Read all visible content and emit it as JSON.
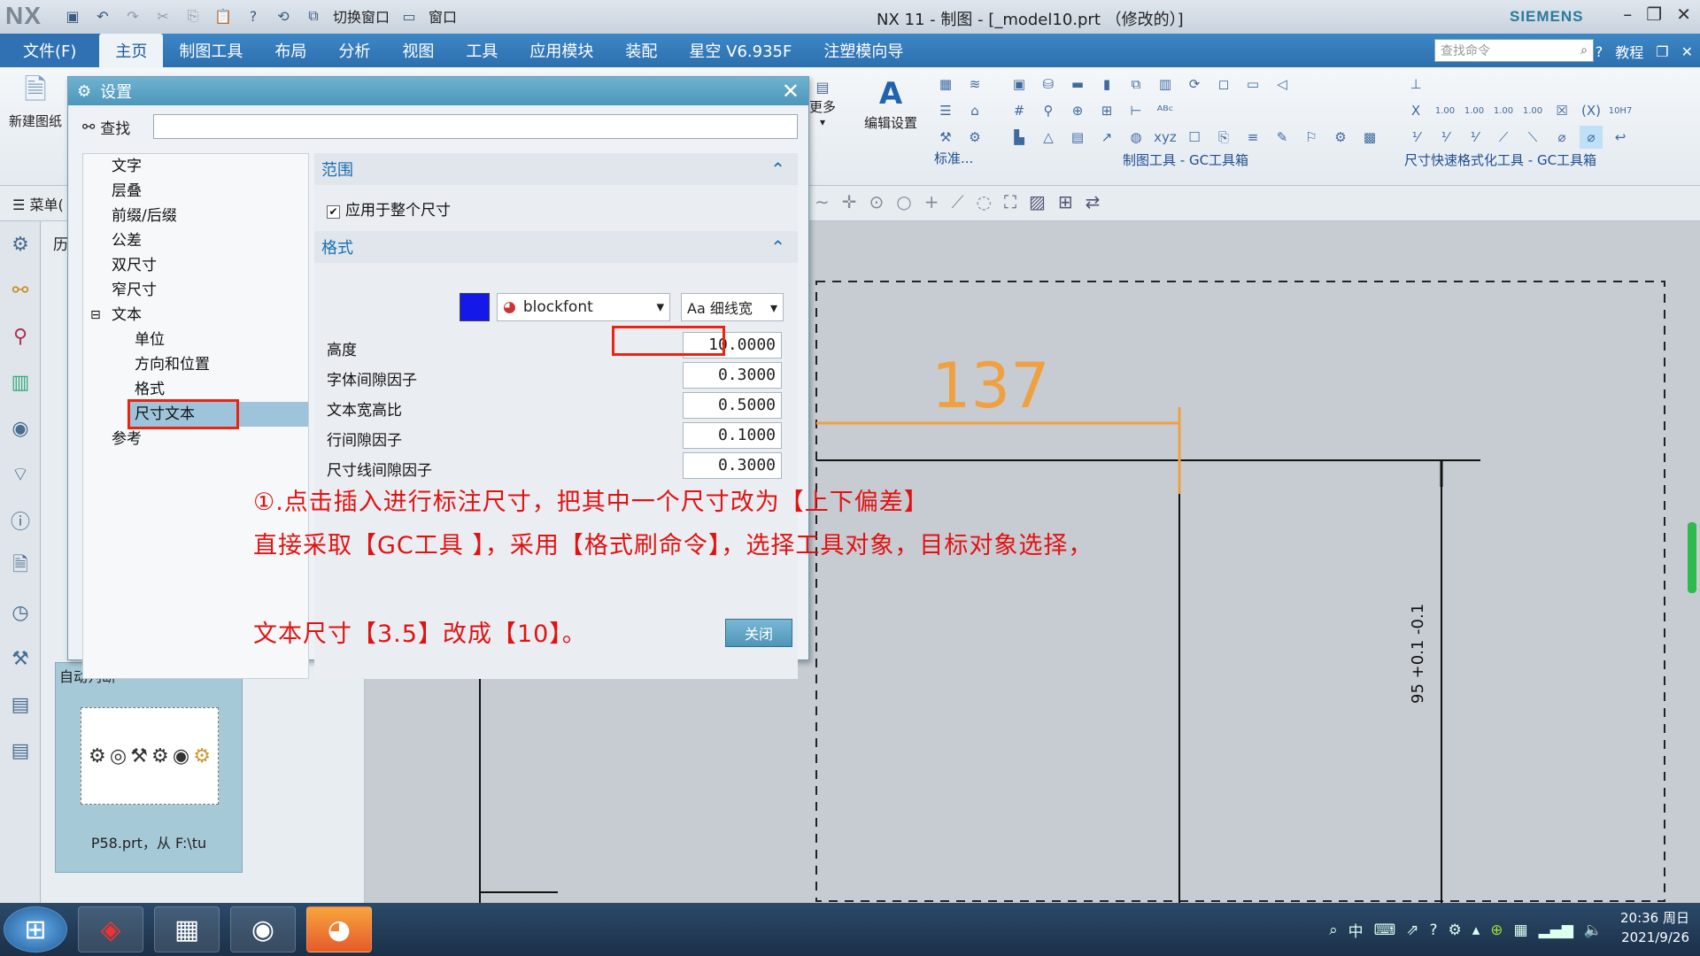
{
  "titlebar": {
    "logo": "NX",
    "switch_window": "切换窗口",
    "window": "窗口",
    "title": "NX 11 - 制图 - [_model10.prt （修改的）]",
    "brand": "SIEMENS"
  },
  "menu": {
    "tabs": [
      "文件(F)",
      "主页",
      "制图工具",
      "布局",
      "分析",
      "视图",
      "工具",
      "应用模块",
      "装配",
      "星空 V6.935F",
      "注塑模向导"
    ],
    "active_tab": "主页",
    "search_placeholder": "查找命令",
    "tutorial": "教程"
  },
  "ribbon": {
    "new_sheet": "新建图纸",
    "more": "更多",
    "edit_settings": "编辑设置",
    "standard": "标准...",
    "group_gc": "制图工具 - GC工具箱",
    "group_dim": "尺寸快速格式化工具 - GC工具箱",
    "dim_labels": [
      "1.00",
      "1.00",
      "1.00",
      "1.00",
      "10H7"
    ]
  },
  "toolbar2": {
    "menu": "菜单("
  },
  "resource": {
    "history_label": "历",
    "auto_label": "自动判断",
    "file_label": "P58.prt，从 F:\\tu"
  },
  "dialog": {
    "title": "设置",
    "find_label": "查找",
    "tree": [
      "文字",
      "层叠",
      "前缀/后缀",
      "公差",
      "双尺寸",
      "窄尺寸",
      "文本",
      "单位",
      "方向和位置",
      "格式",
      "尺寸文本",
      "参考"
    ],
    "selected_tree_item": "尺寸文本",
    "scope_header": "范围",
    "apply_all": "应用于整个尺寸",
    "apply_all_checked": true,
    "format_header": "格式",
    "color": "#1418e8",
    "font": "blockfont",
    "style": "Aa 细线宽",
    "fields": [
      {
        "label": "高度",
        "value": "10.0000"
      },
      {
        "label": "字体间隙因子",
        "value": "0.3000"
      },
      {
        "label": "文本宽高比",
        "value": "0.5000"
      },
      {
        "label": "行间隙因子",
        "value": "0.1000"
      },
      {
        "label": "尺寸线间隙因子",
        "value": "0.3000"
      }
    ],
    "close_button": "关闭"
  },
  "annotation": {
    "line1": "①.点击插入进行标注尺寸，把其中一个尺寸改为【上下偏差】",
    "line2": "直接采取【GC工具  】，采用【格式刷命令】，选择工具对象，目标对象选择，",
    "line3": "文本尺寸【3.5】改成【10】。"
  },
  "drawing": {
    "dim_value": "137",
    "vertical_dim": "95 +0.1 -0.1"
  },
  "taskbar": {
    "time": "20:36 周日",
    "date": "2021/9/26"
  }
}
